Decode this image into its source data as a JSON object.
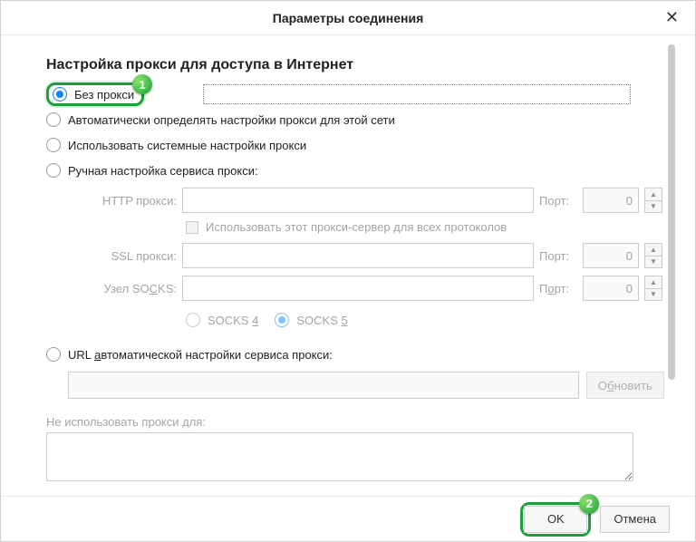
{
  "title": "Параметры соединения",
  "heading": "Настройка прокси для доступа в Интернет",
  "radios": {
    "no_proxy": "Без прокси",
    "auto_detect": "Автоматически определять настройки прокси для этой сети",
    "system": "Использовать системные настройки прокси",
    "manual": "Ручная настройка сервиса прокси:",
    "pac": "URL автоматической настройки сервиса прокси:"
  },
  "fields": {
    "http_label": "HTTP прокси:",
    "ssl_label": "SSL прокси:",
    "socks_label": "Узел SOCKS:",
    "port_label": "Порт:",
    "port_default": "0",
    "use_for_all": "Использовать этот прокси-сервер для всех протоколов",
    "socks4": "SOCKS 4",
    "socks5": "SOCKS 5"
  },
  "pac": {
    "reload": "Обновить"
  },
  "no_proxy_for": "Не использовать прокси для:",
  "buttons": {
    "ok": "OK",
    "cancel": "Отмена"
  },
  "badges": {
    "one": "1",
    "two": "2"
  }
}
